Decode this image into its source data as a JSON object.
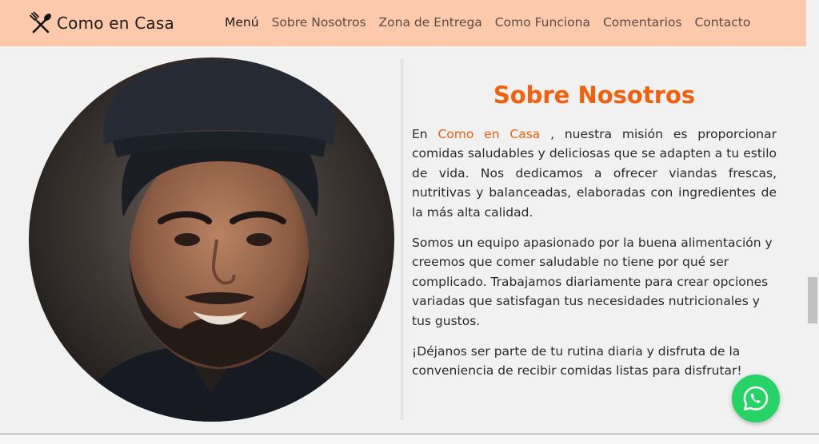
{
  "brand": {
    "name": "Como en Casa",
    "icon": "crossed-fork-spoon-icon"
  },
  "nav": {
    "items": [
      {
        "label": "Menú",
        "active": true
      },
      {
        "label": "Sobre Nosotros",
        "active": false
      },
      {
        "label": "Zona de Entrega",
        "active": false
      },
      {
        "label": "Como Funciona",
        "active": false
      },
      {
        "label": "Comentarios",
        "active": false
      },
      {
        "label": "Contacto",
        "active": false
      }
    ]
  },
  "about": {
    "title": "Sobre Nosotros",
    "p1_prefix": "En ",
    "p1_highlight": "Como en Casa",
    "p1_rest": " , nuestra misión es proporcionar comidas saludables y deliciosas que se adapten a tu estilo de vida. Nos dedicamos a ofrecer viandas frescas, nutritivas y balanceadas, elaboradas con ingredientes de la más alta calidad.",
    "p2": "Somos un equipo apasionado por la buena alimentación y creemos que comer saludable no tiene por qué ser complicado. Trabajamos diariamente para crear opciones variadas que satisfagan tus necesidades nutricionales y tus gustos.",
    "p3": "¡Déjanos ser parte de tu rutina diaria y disfruta de la conveniencia de recibir comidas listas para disfrutar!"
  },
  "colors": {
    "navbar_bg": "#fdc9ad",
    "accent": "#f2600c",
    "whatsapp": "#25d366",
    "page_bg": "#f1f1f1"
  },
  "photo": {
    "subject": "smiling-chef-portrait"
  },
  "floating": {
    "icon": "whatsapp-icon"
  }
}
